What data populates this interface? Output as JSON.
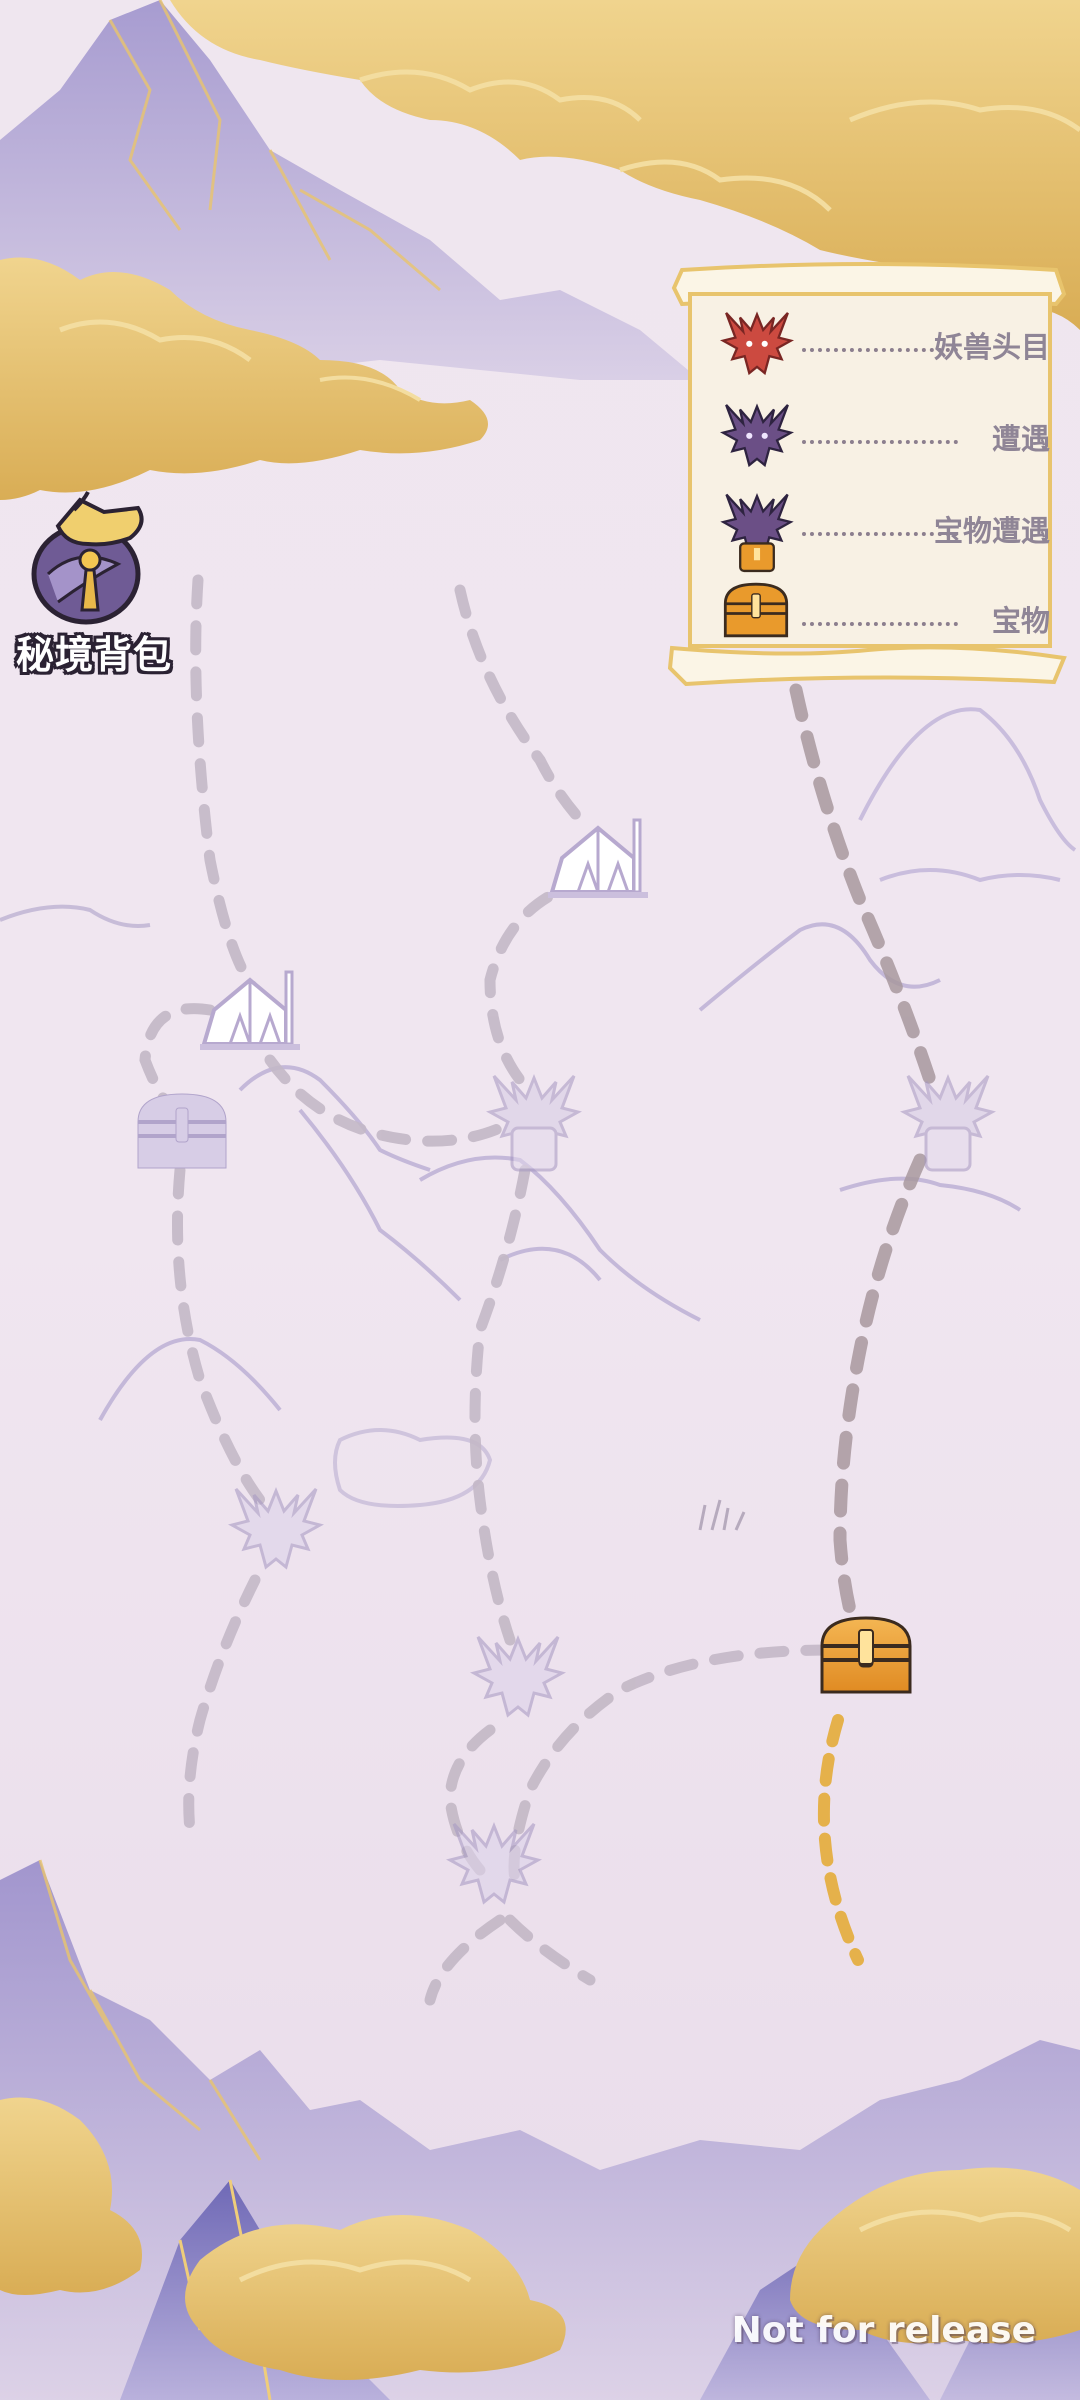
{
  "backpack": {
    "label": "秘境背包",
    "icon": "backpack-pouch-icon"
  },
  "legend": {
    "items": [
      {
        "icon": "red-demon-boss-icon",
        "label": "妖兽头目"
      },
      {
        "icon": "purple-demon-encounter-icon",
        "label": "遭遇"
      },
      {
        "icon": "demon-treasure-encounter-icon",
        "label": "宝物遭遇"
      },
      {
        "icon": "treasure-chest-icon",
        "label": "宝物"
      }
    ]
  },
  "map_nodes": [
    {
      "type": "camp",
      "state": "locked"
    },
    {
      "type": "camp",
      "state": "locked"
    },
    {
      "type": "treasure",
      "state": "locked"
    },
    {
      "type": "treasure-encounter",
      "state": "locked"
    },
    {
      "type": "treasure-encounter",
      "state": "locked"
    },
    {
      "type": "encounter",
      "state": "locked"
    },
    {
      "type": "encounter",
      "state": "locked"
    },
    {
      "type": "encounter",
      "state": "locked"
    },
    {
      "type": "treasure",
      "state": "available"
    }
  ],
  "watermark": "Not for release",
  "colors": {
    "background": "#eee4ee",
    "cloud_gold": "#e6c274",
    "mountain_purple": "#a99ad0",
    "path_gray": "#b5aab8",
    "path_gold": "#e7b54a",
    "boss_red": "#c9433c",
    "encounter_purple": "#6b4f86",
    "chest_orange": "#e99a2c"
  }
}
